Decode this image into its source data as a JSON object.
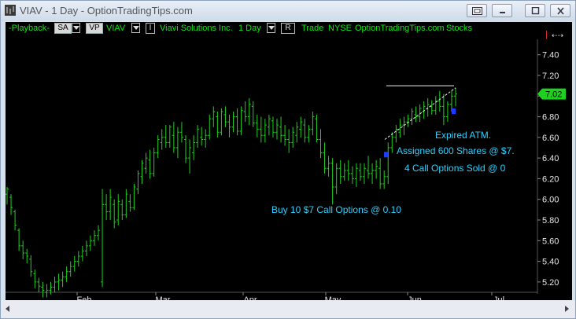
{
  "window": {
    "title": "VIAV - 1 Day - OptionTradingTips.com"
  },
  "toolbar": {
    "playback_label": "-Playback-",
    "sa_label": "SA",
    "vp_label": "VP",
    "symbol_label": "VIAV",
    "interval_box": "I",
    "company_label": "Viavi Solutions Inc.",
    "period_label": "1 Day",
    "r_box": "R",
    "trade_label": "Trade",
    "exchange_label": "NYSE",
    "site_label": "OptionTradingTips.com",
    "stocks_label": "Stocks"
  },
  "side": {
    "pin_icon": "|",
    "expand_icon": "⇠⇢"
  },
  "colors": {
    "bars": "#1fd11f",
    "annotation": "#2fd0ff",
    "price_tag": "#1fd11f",
    "marker": "#1a3cff"
  },
  "chart_data": {
    "type": "ohlc",
    "symbol": "VIAV",
    "ylim": [
      5.1,
      7.55
    ],
    "yticks": [
      "7.40",
      "7.20",
      "7.00",
      "6.80",
      "6.60",
      "6.40",
      "6.20",
      "6.00",
      "5.80",
      "5.60",
      "5.40",
      "5.20"
    ],
    "xticks": [
      "Feb",
      "Mar",
      "Apr",
      "May",
      "Jun",
      "Jul"
    ],
    "last_price": "7.02",
    "annotations": {
      "buy": "Buy 10 $7 Call Options @ 0.10",
      "assigned": "Assigned 600 Shares @ $7.",
      "sold": "4 Call Options Sold @ 0",
      "expired": "Expired ATM."
    },
    "strike_line": 7.1,
    "series": [
      [
        6.05,
        6.12,
        5.95,
        6.1
      ],
      [
        6.02,
        6.05,
        5.85,
        5.92
      ],
      [
        5.88,
        5.9,
        5.7,
        5.75
      ],
      [
        5.7,
        5.72,
        5.5,
        5.55
      ],
      [
        5.55,
        5.6,
        5.42,
        5.48
      ],
      [
        5.48,
        5.52,
        5.38,
        5.45
      ],
      [
        5.42,
        5.46,
        5.25,
        5.3
      ],
      [
        5.28,
        5.32,
        5.14,
        5.2
      ],
      [
        5.2,
        5.24,
        5.1,
        5.16
      ],
      [
        5.15,
        5.2,
        5.05,
        5.12
      ],
      [
        5.1,
        5.18,
        5.05,
        5.12
      ],
      [
        5.12,
        5.2,
        5.08,
        5.15
      ],
      [
        5.15,
        5.25,
        5.1,
        5.2
      ],
      [
        5.2,
        5.28,
        5.12,
        5.22
      ],
      [
        5.22,
        5.3,
        5.15,
        5.25
      ],
      [
        5.25,
        5.35,
        5.2,
        5.3
      ],
      [
        5.3,
        5.4,
        5.25,
        5.35
      ],
      [
        5.35,
        5.45,
        5.3,
        5.4
      ],
      [
        5.4,
        5.5,
        5.35,
        5.45
      ],
      [
        5.45,
        5.55,
        5.4,
        5.5
      ],
      [
        5.5,
        5.6,
        5.45,
        5.55
      ],
      [
        5.55,
        5.65,
        5.5,
        5.6
      ],
      [
        5.6,
        5.7,
        5.55,
        5.65
      ],
      [
        5.65,
        5.75,
        5.6,
        5.7
      ],
      [
        5.2,
        6.1,
        5.15,
        5.95
      ],
      [
        5.95,
        6.05,
        5.8,
        5.88
      ],
      [
        5.88,
        6.1,
        5.8,
        6.02
      ],
      [
        5.95,
        6.0,
        5.72,
        5.78
      ],
      [
        5.8,
        6.05,
        5.75,
        5.98
      ],
      [
        5.95,
        6.0,
        5.8,
        5.85
      ],
      [
        5.85,
        6.1,
        5.82,
        6.05
      ],
      [
        5.98,
        6.05,
        5.88,
        5.92
      ],
      [
        5.92,
        6.15,
        5.9,
        6.12
      ],
      [
        6.1,
        6.28,
        6.05,
        6.25
      ],
      [
        6.22,
        6.38,
        6.15,
        6.35
      ],
      [
        6.3,
        6.45,
        6.25,
        6.4
      ],
      [
        6.38,
        6.48,
        6.2,
        6.25
      ],
      [
        6.25,
        6.5,
        6.22,
        6.45
      ],
      [
        6.45,
        6.62,
        6.4,
        6.58
      ],
      [
        6.55,
        6.68,
        6.48,
        6.6
      ],
      [
        6.6,
        6.72,
        6.5,
        6.55
      ],
      [
        6.55,
        6.72,
        6.5,
        6.7
      ],
      [
        6.62,
        6.75,
        6.45,
        6.5
      ],
      [
        6.5,
        6.7,
        6.4,
        6.65
      ],
      [
        6.65,
        6.75,
        6.55,
        6.6
      ],
      [
        6.58,
        6.62,
        6.35,
        6.4
      ],
      [
        6.4,
        6.58,
        6.25,
        6.5
      ],
      [
        6.45,
        6.62,
        6.38,
        6.55
      ],
      [
        6.55,
        6.72,
        6.5,
        6.68
      ],
      [
        6.6,
        6.7,
        6.52,
        6.58
      ],
      [
        6.58,
        6.68,
        6.5,
        6.62
      ],
      [
        6.62,
        6.82,
        6.58,
        6.78
      ],
      [
        6.78,
        6.9,
        6.7,
        6.85
      ],
      [
        6.8,
        6.85,
        6.6,
        6.65
      ],
      [
        6.65,
        6.88,
        6.62,
        6.85
      ],
      [
        6.82,
        6.9,
        6.7,
        6.75
      ],
      [
        6.75,
        6.82,
        6.6,
        6.7
      ],
      [
        6.7,
        6.85,
        6.65,
        6.8
      ],
      [
        6.8,
        6.88,
        6.62,
        6.66
      ],
      [
        6.66,
        6.9,
        6.62,
        6.86
      ],
      [
        6.85,
        6.95,
        6.75,
        6.8
      ],
      [
        6.8,
        6.98,
        6.72,
        6.92
      ],
      [
        6.9,
        6.95,
        6.7,
        6.74
      ],
      [
        6.74,
        6.82,
        6.6,
        6.68
      ],
      [
        6.68,
        6.8,
        6.55,
        6.62
      ],
      [
        6.62,
        6.78,
        6.55,
        6.72
      ],
      [
        6.7,
        6.82,
        6.62,
        6.78
      ],
      [
        6.76,
        6.8,
        6.6,
        6.65
      ],
      [
        6.65,
        6.78,
        6.58,
        6.72
      ],
      [
        6.7,
        6.8,
        6.55,
        6.62
      ],
      [
        6.62,
        6.72,
        6.52,
        6.58
      ],
      [
        6.58,
        6.68,
        6.45,
        6.55
      ],
      [
        6.55,
        6.7,
        6.5,
        6.65
      ],
      [
        6.62,
        6.75,
        6.55,
        6.7
      ],
      [
        6.68,
        6.8,
        6.6,
        6.75
      ],
      [
        6.72,
        6.78,
        6.55,
        6.6
      ],
      [
        6.6,
        6.72,
        6.55,
        6.68
      ],
      [
        6.68,
        6.85,
        6.62,
        6.8
      ],
      [
        6.78,
        6.82,
        6.55,
        6.58
      ],
      [
        6.58,
        6.68,
        6.4,
        6.45
      ],
      [
        6.45,
        6.55,
        6.25,
        6.3
      ],
      [
        6.3,
        6.42,
        6.22,
        6.35
      ],
      [
        6.35,
        6.4,
        5.95,
        6.12
      ],
      [
        6.12,
        6.35,
        6.05,
        6.3
      ],
      [
        6.3,
        6.38,
        6.15,
        6.22
      ],
      [
        6.22,
        6.35,
        6.18,
        6.28
      ],
      [
        6.28,
        6.38,
        6.18,
        6.25
      ],
      [
        6.25,
        6.32,
        6.15,
        6.2
      ],
      [
        6.2,
        6.35,
        6.12,
        6.3
      ],
      [
        6.28,
        6.35,
        6.18,
        6.22
      ],
      [
        6.22,
        6.35,
        6.15,
        6.3
      ],
      [
        6.28,
        6.42,
        6.2,
        6.25
      ],
      [
        6.25,
        6.35,
        6.15,
        6.28
      ],
      [
        6.28,
        6.38,
        6.2,
        6.32
      ],
      [
        6.3,
        6.4,
        6.1,
        6.15
      ],
      [
        6.15,
        6.28,
        6.1,
        6.22
      ],
      [
        6.22,
        6.55,
        6.15,
        6.5
      ],
      [
        6.5,
        6.65,
        6.45,
        6.6
      ],
      [
        6.6,
        6.72,
        6.55,
        6.68
      ],
      [
        6.65,
        6.78,
        6.6,
        6.72
      ],
      [
        6.72,
        6.8,
        6.62,
        6.75
      ],
      [
        6.75,
        6.82,
        6.7,
        6.78
      ],
      [
        6.78,
        6.88,
        6.72,
        6.85
      ],
      [
        6.82,
        6.9,
        6.75,
        6.8
      ],
      [
        6.8,
        6.92,
        6.75,
        6.88
      ],
      [
        6.85,
        6.95,
        6.78,
        6.9
      ],
      [
        6.88,
        6.98,
        6.8,
        6.92
      ],
      [
        6.9,
        6.96,
        6.82,
        6.86
      ],
      [
        6.86,
        7.0,
        6.82,
        6.95
      ],
      [
        6.95,
        7.05,
        6.85,
        6.9
      ],
      [
        6.9,
        7.02,
        6.72,
        6.8
      ],
      [
        6.8,
        6.95,
        6.75,
        6.92
      ],
      [
        6.92,
        7.05,
        6.85,
        7.0
      ],
      [
        7.0,
        7.08,
        6.9,
        7.02
      ]
    ]
  }
}
